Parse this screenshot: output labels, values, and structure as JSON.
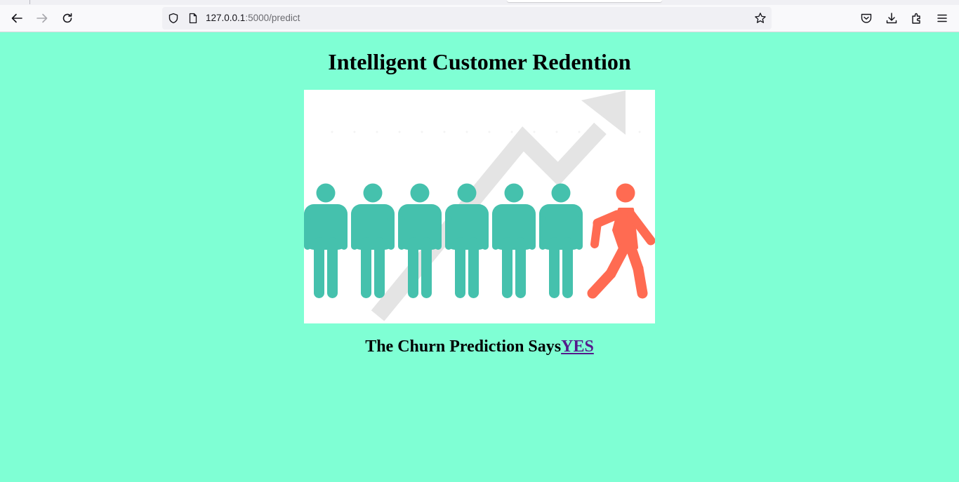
{
  "browser": {
    "url_host": "127.0.0.1",
    "url_rest": ":5000/predict"
  },
  "page": {
    "title": "Intelligent Customer Redention",
    "result_prefix": "The Churn Prediction Says",
    "result_value": "YES",
    "colors": {
      "background": "#7fffd4",
      "figure_teal": "#45c1ad",
      "figure_orange": "#ff6b52",
      "arrow_gray": "#e4e4e4",
      "link": "#551a8b"
    }
  }
}
